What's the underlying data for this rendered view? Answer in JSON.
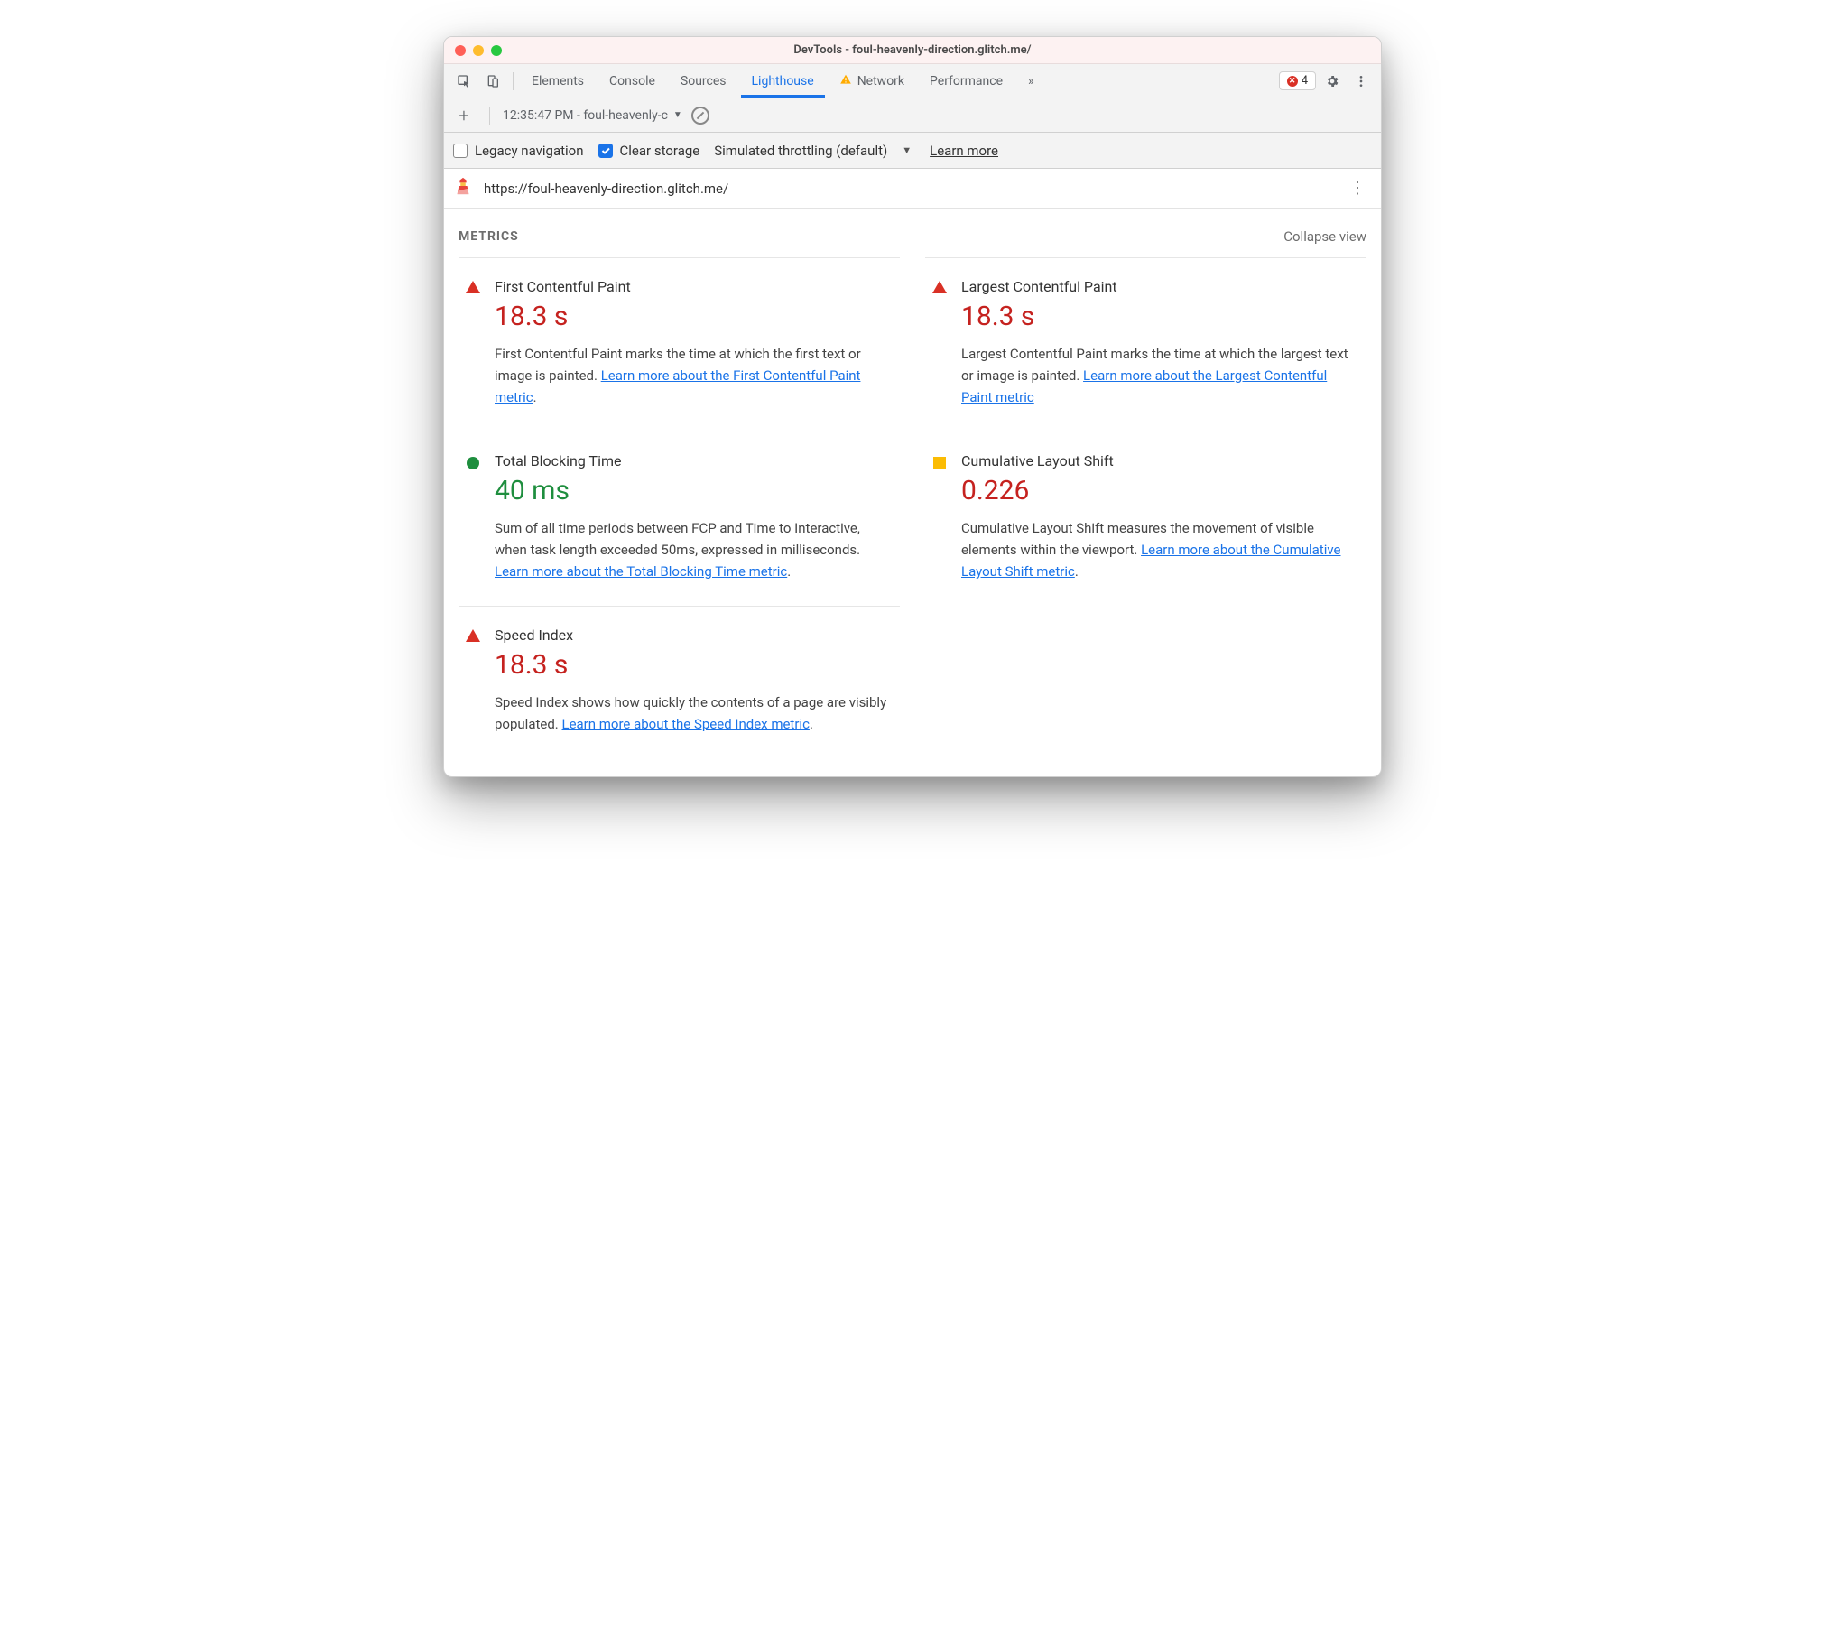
{
  "window": {
    "title": "DevTools - foul-heavenly-direction.glitch.me/"
  },
  "tabs": {
    "elements": "Elements",
    "console": "Console",
    "sources": "Sources",
    "lighthouse": "Lighthouse",
    "network": "Network",
    "performance": "Performance",
    "more": "»",
    "error_count": "4"
  },
  "toolbar2": {
    "report_label": "12:35:47 PM - foul-heavenly-c"
  },
  "toolbar3": {
    "legacy_nav": "Legacy navigation",
    "clear_storage": "Clear storage",
    "throttling": "Simulated throttling (default)",
    "learn_more": "Learn more"
  },
  "url_bar": {
    "url": "https://foul-heavenly-direction.glitch.me/"
  },
  "metrics_header": {
    "title": "METRICS",
    "collapse": "Collapse view"
  },
  "metrics": {
    "fcp": {
      "name": "First Contentful Paint",
      "value": "18.3 s",
      "desc": "First Contentful Paint marks the time at which the first text or image is painted. ",
      "link": "Learn more about the First Contentful Paint metric",
      "suffix": "."
    },
    "lcp": {
      "name": "Largest Contentful Paint",
      "value": "18.3 s",
      "desc": "Largest Contentful Paint marks the time at which the largest text or image is painted. ",
      "link": "Learn more about the Largest Contentful Paint metric",
      "suffix": ""
    },
    "tbt": {
      "name": "Total Blocking Time",
      "value": "40 ms",
      "desc": "Sum of all time periods between FCP and Time to Interactive, when task length exceeded 50ms, expressed in milliseconds. ",
      "link": "Learn more about the Total Blocking Time metric",
      "suffix": "."
    },
    "cls": {
      "name": "Cumulative Layout Shift",
      "value": "0.226",
      "desc": "Cumulative Layout Shift measures the movement of visible elements within the viewport. ",
      "link": "Learn more about the Cumulative Layout Shift metric",
      "suffix": "."
    },
    "si": {
      "name": "Speed Index",
      "value": "18.3 s",
      "desc": "Speed Index shows how quickly the contents of a page are visibly populated. ",
      "link": "Learn more about the Speed Index metric",
      "suffix": "."
    }
  }
}
